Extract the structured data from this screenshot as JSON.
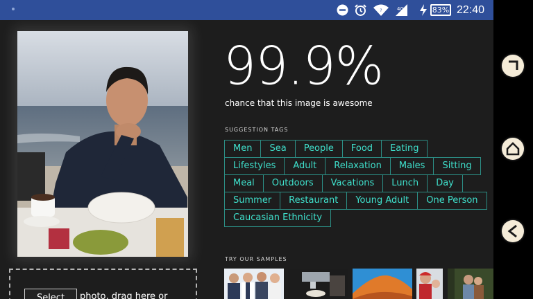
{
  "status_bar": {
    "battery_percent": "83",
    "battery_suffix": "%",
    "time": "22:40",
    "icons": [
      "dnd-icon",
      "alarm-icon",
      "wifi-icon",
      "signal-icon",
      "charging-icon"
    ]
  },
  "result": {
    "percentage": "99.9%",
    "caption": "chance that this image is awesome"
  },
  "suggestion_tags": {
    "label": "SUGGESTION TAGS",
    "rows": [
      [
        "Men",
        "Sea",
        "People",
        "Food",
        "Eating"
      ],
      [
        "Lifestyles",
        "Adult",
        "Relaxation",
        "Males",
        "Sitting"
      ],
      [
        "Meal",
        "Outdoors",
        "Vacations",
        "Lunch",
        "Day"
      ],
      [
        "Summer",
        "Restaurant",
        "Young Adult",
        "One Person"
      ],
      [
        "Caucasian Ethnicity"
      ]
    ]
  },
  "samples": {
    "label": "TRY OUR SAMPLES",
    "items": [
      "sample-business-people",
      "sample-coffee-machine",
      "sample-desert-dunes",
      "sample-family-winter",
      "sample-couple-forest"
    ]
  },
  "upload": {
    "select_label": "Select",
    "drop_text": "photo, drag here or"
  },
  "nav": {
    "buttons": [
      "recents-icon",
      "home-icon",
      "back-icon"
    ]
  },
  "colors": {
    "status_bar": "#2f4f9a",
    "background": "#1d1d1d",
    "tag_border": "#2c8f86",
    "tag_text": "#3fe0cc",
    "nav_button": "#f5ecd8"
  }
}
